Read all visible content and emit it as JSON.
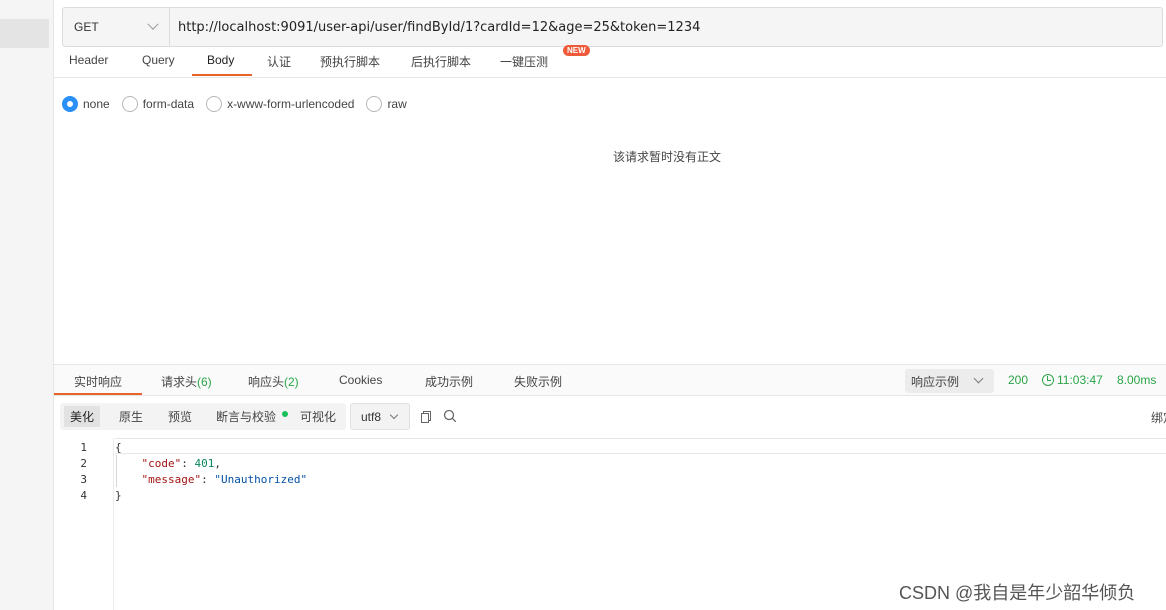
{
  "request": {
    "method": "GET",
    "url": "http://localhost:9091/user-api/user/findById/1?cardId=12&age=25&token=1234"
  },
  "request_tabs": [
    {
      "label": "Header"
    },
    {
      "label": "Query"
    },
    {
      "label": "Body"
    },
    {
      "label": "认证"
    },
    {
      "label": "预执行脚本"
    },
    {
      "label": "后执行脚本"
    },
    {
      "label": "一键压测"
    }
  ],
  "active_request_tab": "Body",
  "new_badge": "NEW",
  "body_types": [
    {
      "label": "none",
      "selected": true
    },
    {
      "label": "form-data",
      "selected": false
    },
    {
      "label": "x-www-form-urlencoded",
      "selected": false
    },
    {
      "label": "raw",
      "selected": false
    }
  ],
  "empty_body_message": "该请求暂时没有正文",
  "response_tabs": [
    {
      "label": "实时响应",
      "count": ""
    },
    {
      "label": "请求头",
      "count": "(6)"
    },
    {
      "label": "响应头",
      "count": "(2)"
    },
    {
      "label": "Cookies",
      "count": ""
    },
    {
      "label": "成功示例",
      "count": ""
    },
    {
      "label": "失败示例",
      "count": ""
    }
  ],
  "response_example_dropdown": "响应示例",
  "status": {
    "code": "200",
    "time": "11:03:47",
    "duration": "8.00ms"
  },
  "view_modes": [
    {
      "label": "美化",
      "active": true
    },
    {
      "label": "原生",
      "active": false
    },
    {
      "label": "预览",
      "active": false
    },
    {
      "label": "断言与校验",
      "active": false
    },
    {
      "label": "可视化",
      "active": false
    }
  ],
  "encoding": "utf8",
  "bind_label": "绑定",
  "response_body": {
    "line_numbers": [
      "1",
      "2",
      "3",
      "4"
    ],
    "open_brace": "{",
    "code_key": "\"code\"",
    "code_value": "401",
    "message_key": "\"message\"",
    "message_value": "\"Unauthorized\"",
    "close_brace": "}"
  },
  "watermark": "CSDN @我自是年少韶华倾负",
  "colors": {
    "accent": "#e8632c",
    "radio_selected": "#2a8ff7",
    "status_green": "#2aa548",
    "new_badge": "#ee5a3a"
  }
}
